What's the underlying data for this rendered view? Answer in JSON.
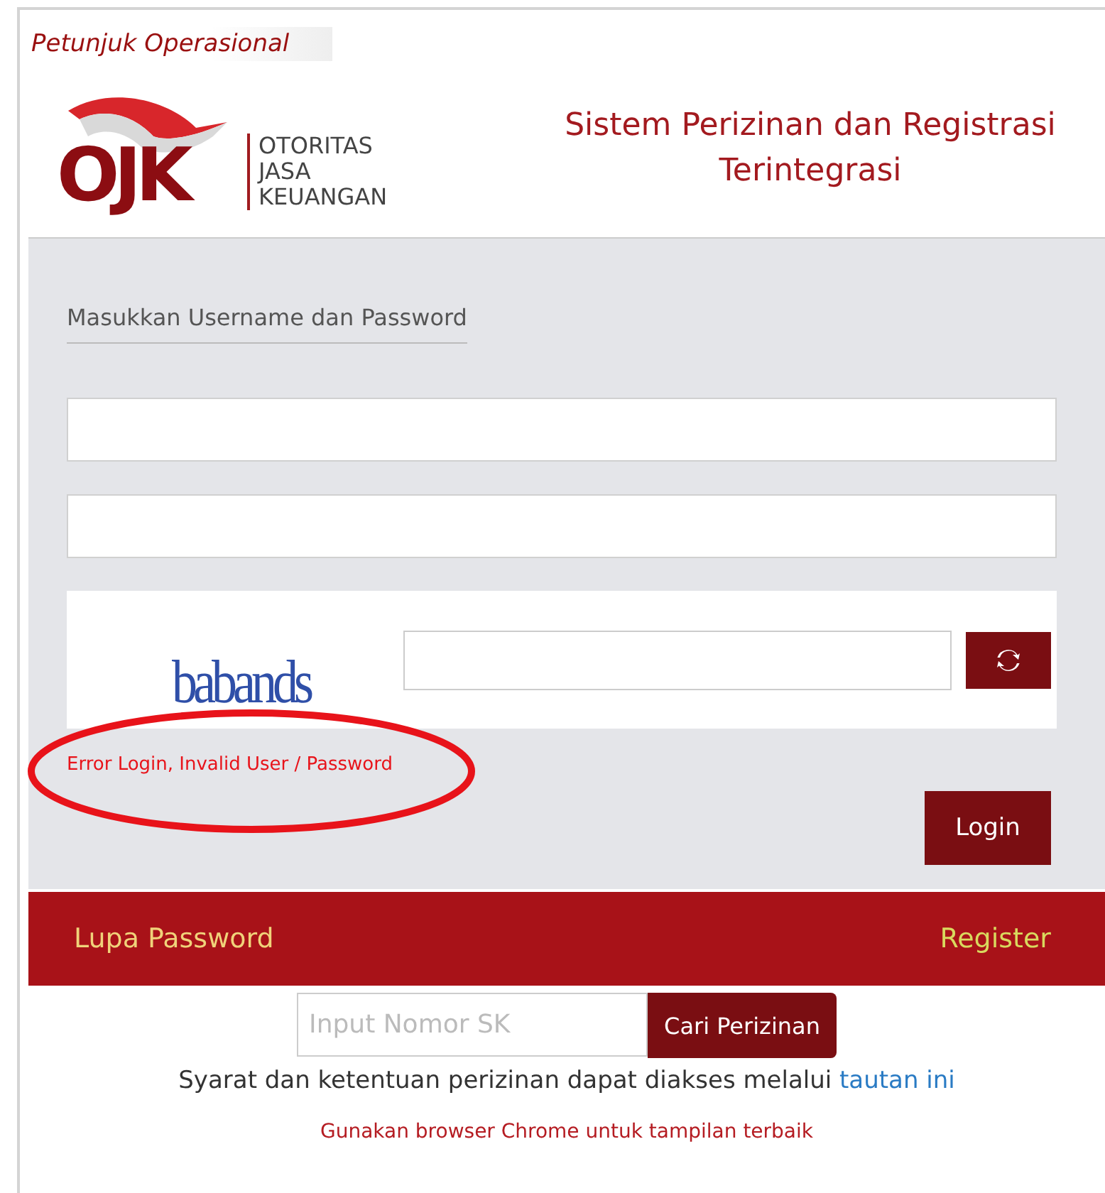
{
  "help_link": "Petunjuk Operasional",
  "logo": {
    "letters": "OJK",
    "lines": [
      "OTORITAS",
      "JASA",
      "KEUANGAN"
    ]
  },
  "header_title": "Sistem Perizinan dan Registrasi Terintegrasi",
  "login": {
    "heading": "Masukkan Username dan Password",
    "captcha_text": "babands",
    "error": "Error Login, Invalid User / Password",
    "error_circled": true,
    "submit": "Login"
  },
  "footer_bar": {
    "left": "Lupa Password",
    "right": "Register"
  },
  "search": {
    "placeholder": "Input Nomor SK",
    "button": "Cari Perizinan"
  },
  "terms": {
    "text": "Syarat dan ketentuan perizinan dapat diakses melalui",
    "link": "tautan ini"
  },
  "browser_note": "Gunakan browser Chrome untuk tampilan terbaik"
}
